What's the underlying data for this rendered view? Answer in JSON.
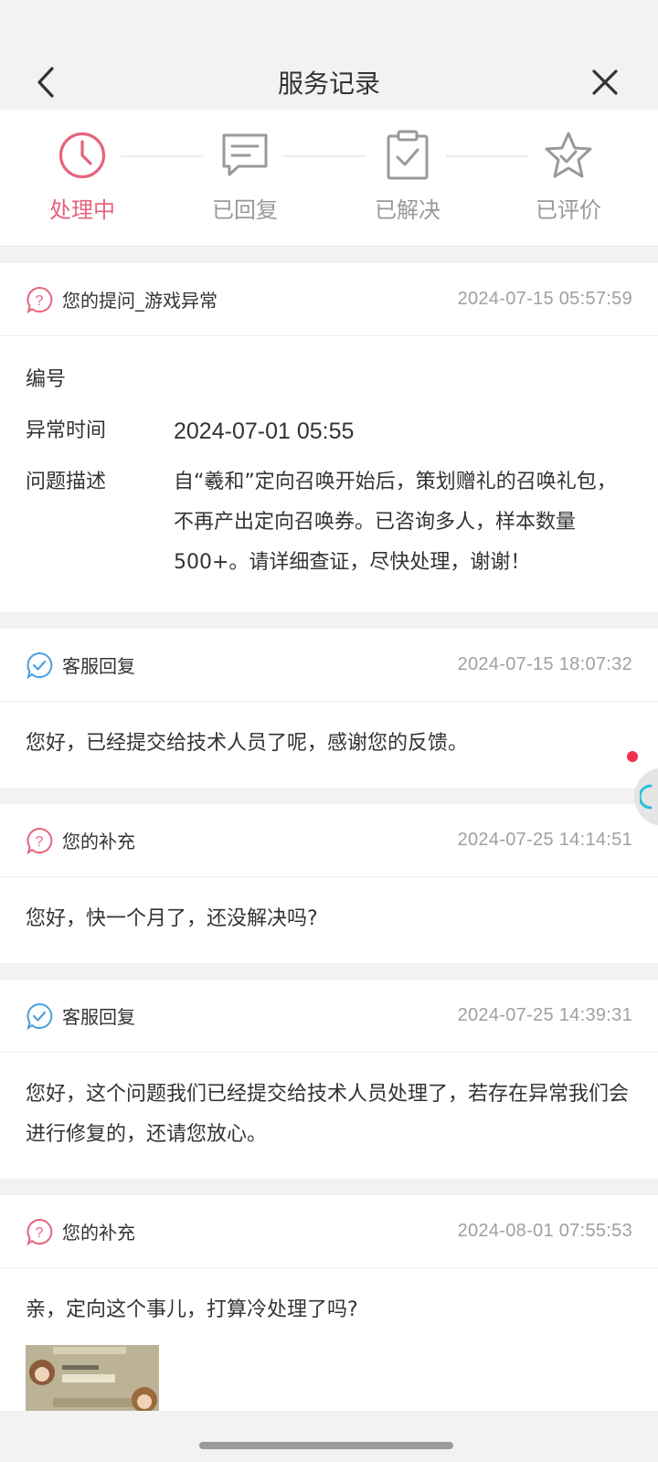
{
  "header": {
    "title": "服务记录",
    "back_icon": "chevron-left-icon",
    "close_icon": "close-icon"
  },
  "steps": [
    {
      "label": "处理中",
      "icon": "clock-icon",
      "active": true
    },
    {
      "label": "已回复",
      "icon": "message-icon",
      "active": false
    },
    {
      "label": "已解决",
      "icon": "clipboard-check-icon",
      "active": false
    },
    {
      "label": "已评价",
      "icon": "star-check-icon",
      "active": false
    }
  ],
  "question": {
    "title": "您的提问_游戏异常",
    "time": "2024-07-15 05:57:59",
    "fields": [
      {
        "key": "编号",
        "value": ""
      },
      {
        "key": "异常时间",
        "value": "2024-07-01 05:55"
      },
      {
        "key": "问题描述",
        "value": "自“羲和”定向召唤开始后，策划赠礼的召唤礼包，不再产出定向召唤券。已咨询多人，样本数量500+。请详细查证，尽快处理，谢谢！"
      }
    ]
  },
  "messages": [
    {
      "title": "客服回复",
      "time": "2024-07-15 18:07:32",
      "body": "您好，已经提交给技术人员了呢，感谢您的反馈。",
      "type": "reply"
    },
    {
      "title": "您的补充",
      "time": "2024-07-25 14:14:51",
      "body": "您好，快一个月了，还没解决吗?",
      "type": "user"
    },
    {
      "title": "客服回复",
      "time": "2024-07-25 14:39:31",
      "body": "您好，这个问题我们已经提交给技术人员处理了，若存在异常我们会进行修复的，还请您放心。",
      "type": "reply"
    },
    {
      "title": "您的补充",
      "time": "2024-08-01 07:55:53",
      "body": "亲，定向这个事儿，打算冷处理了吗?",
      "type": "user"
    }
  ],
  "colors": {
    "accent": "#e6647e",
    "reply_icon": "#4a9fe0",
    "muted": "#a0a0a0"
  }
}
